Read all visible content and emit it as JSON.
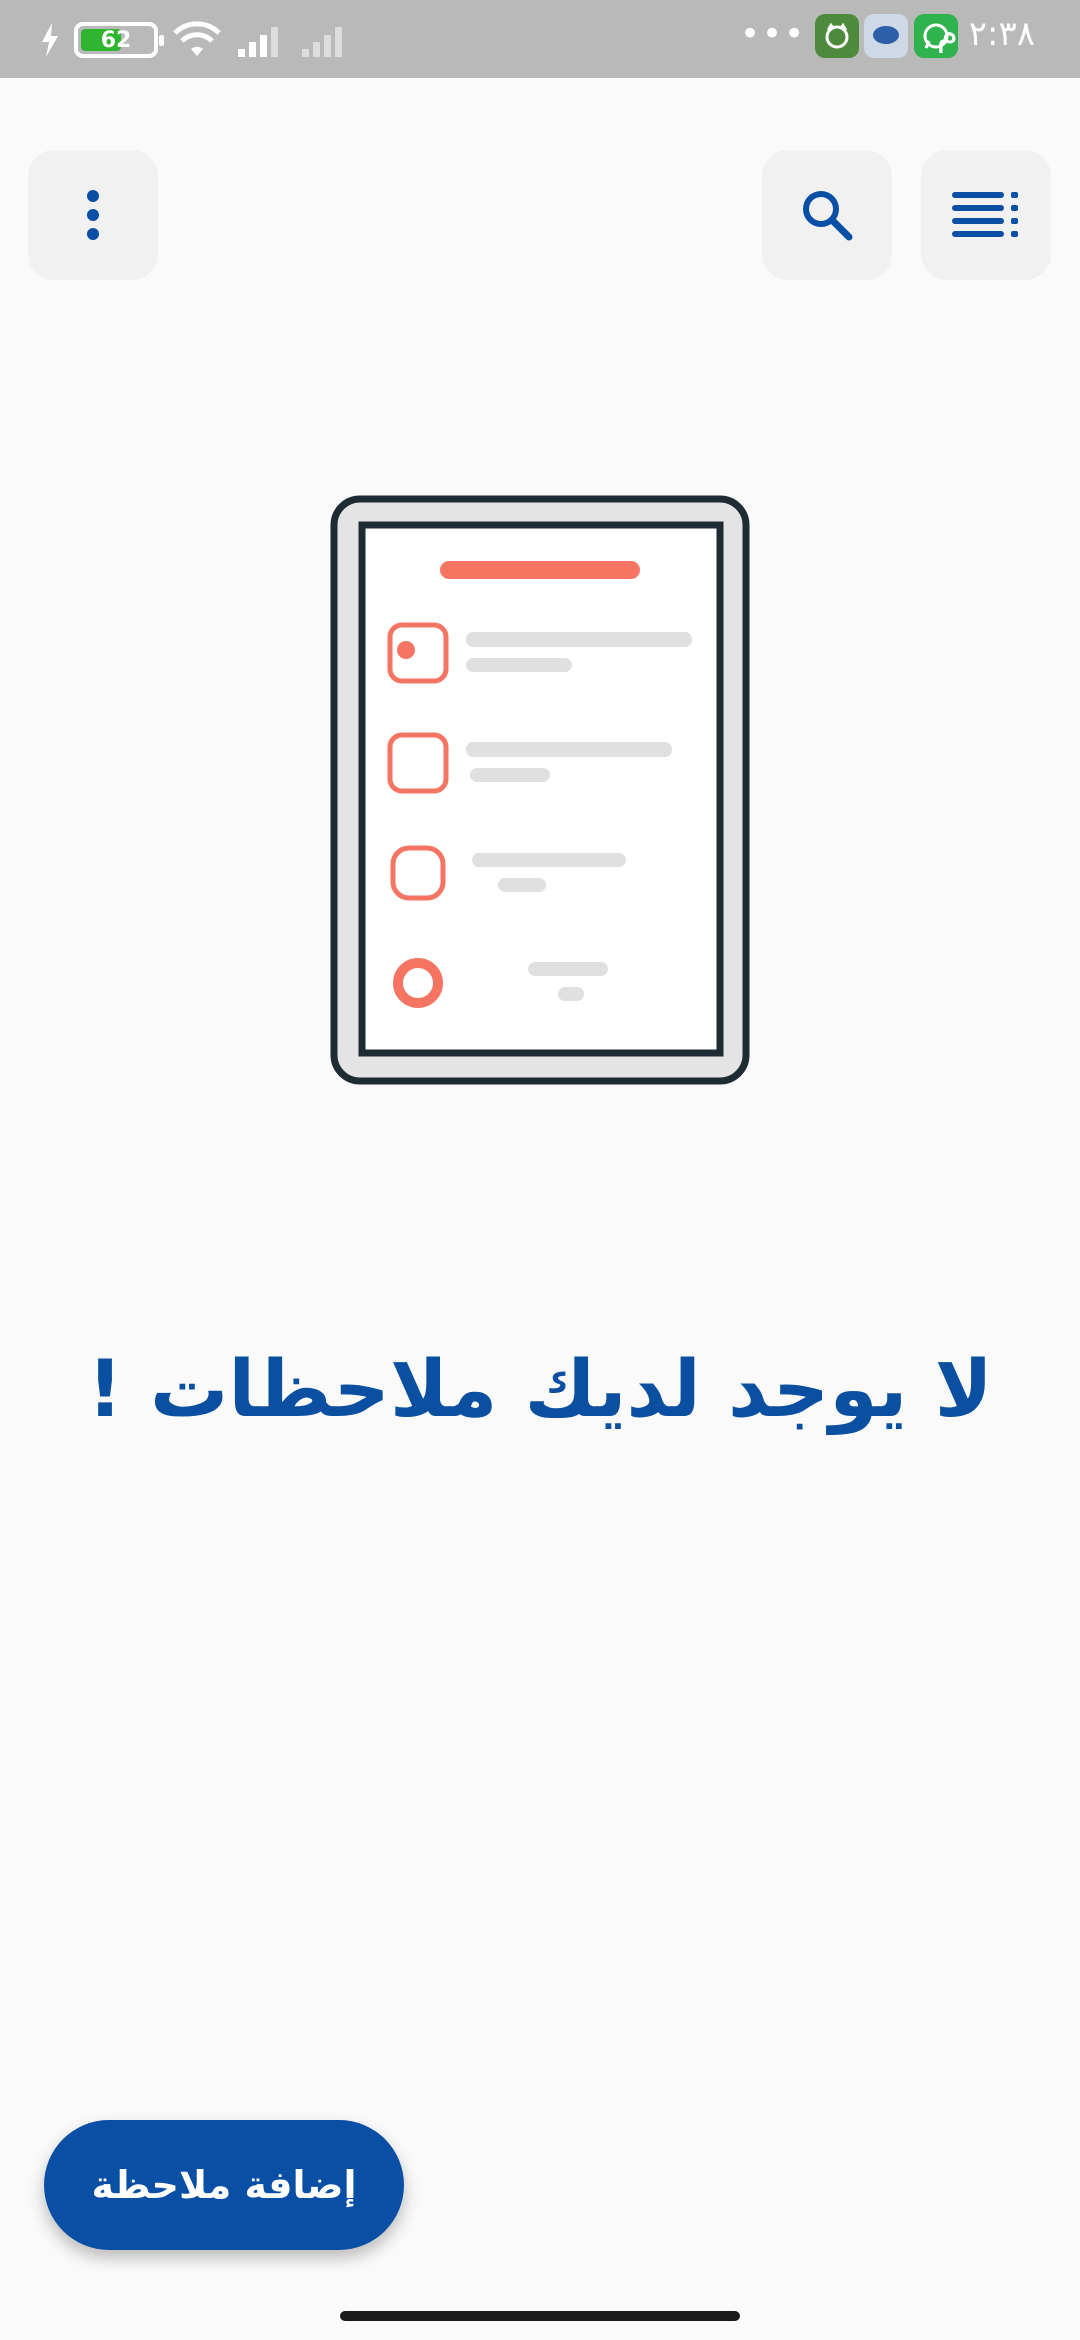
{
  "status_bar": {
    "time": "٢:٣٨ م",
    "battery_level": "62",
    "overflow_dots": "•••",
    "colors": {
      "background": "#b9b9b9",
      "battery_fill": "#2fb52f"
    }
  },
  "toolbar": {
    "menu_icon": "more-vertical-icon",
    "search_icon": "search-icon",
    "list_icon": "list-sort-icon"
  },
  "empty_state": {
    "message": "لا يوجد لديك ملاحظات !"
  },
  "fab": {
    "label": "إضافة ملاحظة"
  },
  "theme": {
    "primary": "#0a4fa6",
    "accent": "#f57462",
    "background": "#fafafa"
  }
}
